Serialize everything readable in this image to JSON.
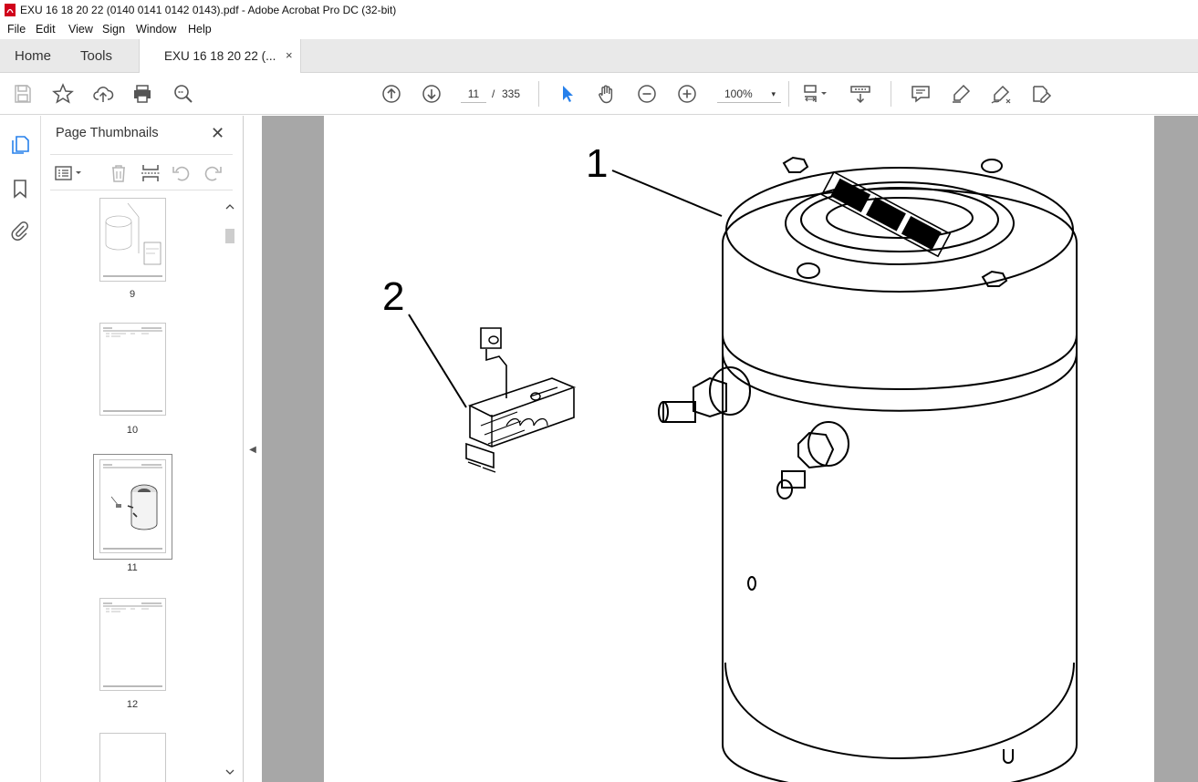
{
  "window": {
    "title": "EXU 16 18 20 22 (0140 0141 0142 0143).pdf - Adobe Acrobat Pro DC (32-bit)"
  },
  "menu": [
    "File",
    "Edit",
    "View",
    "Sign",
    "Window",
    "Help"
  ],
  "tabs": {
    "home": "Home",
    "tools": "Tools",
    "document": "EXU 16 18 20 22 (...",
    "close_symbol": "×"
  },
  "toolbar": {
    "page_current": "11",
    "page_separator": "/",
    "page_total": "335",
    "zoom": "100%",
    "zoom_caret": "▾",
    "icons": [
      "save-icon",
      "bookmark-star-icon",
      "share-upload-icon",
      "print-icon",
      "zoom-find-icon",
      "page-up-icon",
      "page-down-icon",
      "select-cursor-icon",
      "hand-icon",
      "zoom-out-icon",
      "zoom-in-icon",
      "page-fit-icon",
      "scroll-mode-icon",
      "comment-icon",
      "highlight-icon",
      "draw-icon",
      "edit-pdf-icon"
    ]
  },
  "left_rail": {
    "icons": [
      "page-thumbnails-icon",
      "bookmarks-icon",
      "attachments-icon"
    ]
  },
  "thumbnails_panel": {
    "title": "Page Thumbnails",
    "close_symbol": "✕",
    "pages": [
      {
        "number": "9"
      },
      {
        "number": "10"
      },
      {
        "number": "11",
        "selected": true
      },
      {
        "number": "12"
      }
    ]
  },
  "collapse_symbol": "◀",
  "document": {
    "callouts": [
      "1",
      "2"
    ]
  },
  "colors": {
    "accent": "#2680eb",
    "tabbar": "#e9e9e9",
    "doc_background": "#a7a7a7"
  }
}
